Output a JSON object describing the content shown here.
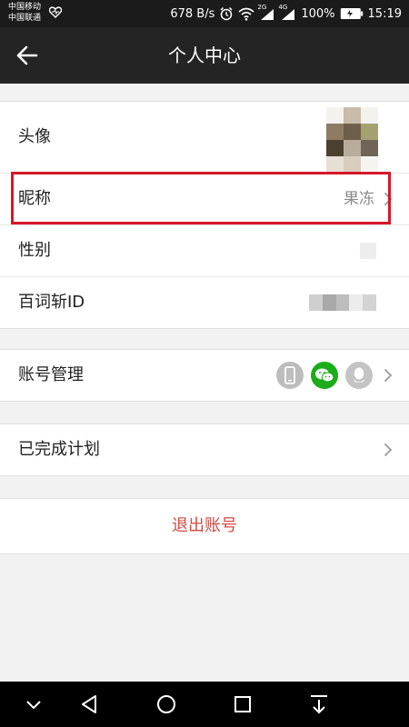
{
  "status_bar": {
    "carrier1": "中国移动",
    "carrier2": "中国联通",
    "speed": "678 B/s",
    "battery": "100%",
    "time": "15:19",
    "network_2g": "2G",
    "network_4g": "4G"
  },
  "header": {
    "title": "个人中心"
  },
  "profile": {
    "avatar_label": "头像",
    "nickname_label": "昵称",
    "nickname_value": "果冻",
    "gender_label": "性别",
    "id_label": "百词斩ID"
  },
  "account": {
    "label": "账号管理",
    "icons": [
      "phone-icon",
      "wechat-icon",
      "qq-icon"
    ],
    "wechat_color": "#1aad19"
  },
  "plans": {
    "label": "已完成计划"
  },
  "logout": {
    "label": "退出账号",
    "color": "#d04b44"
  },
  "highlight_color": "#d6172a",
  "nav": {
    "icons": [
      "chevron-down-icon",
      "back-triangle-icon",
      "home-circle-icon",
      "recents-square-icon",
      "download-icon"
    ]
  }
}
